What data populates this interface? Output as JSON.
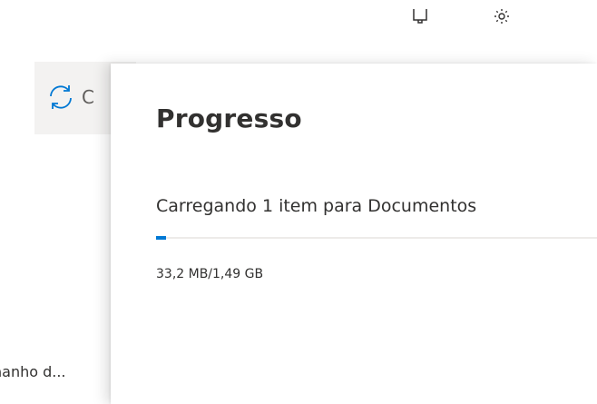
{
  "header": {
    "icons": [
      "megaphone-icon",
      "gear-icon"
    ]
  },
  "toolbar": {
    "sync_label": "C",
    "sync_icon": "sync-icon"
  },
  "list": {
    "column_header": "nanho d..."
  },
  "panel": {
    "title": "Progresso",
    "upload_label": "Carregando 1 item para Documentos",
    "size_text": "33,2 MB/1,49 GB",
    "progress_fraction": 0.0223,
    "accent_color": "#0078d4",
    "track_color": "#edebe9"
  }
}
